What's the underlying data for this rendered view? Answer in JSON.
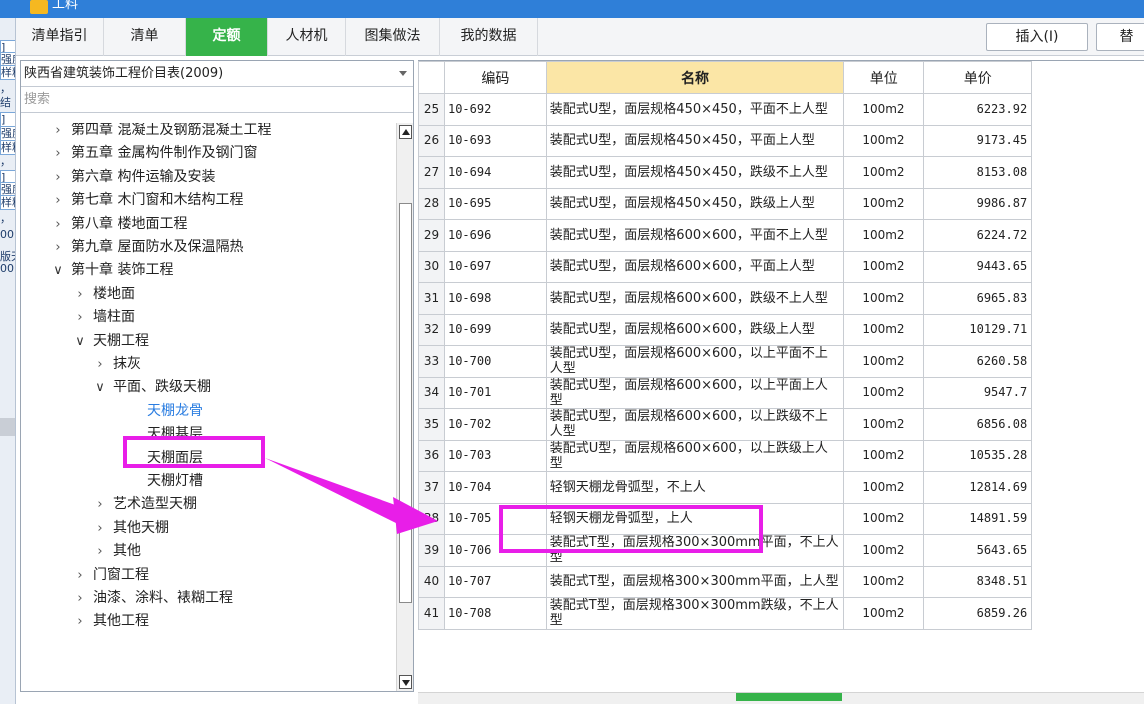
{
  "window": {
    "title": "工料"
  },
  "left_sliver": {
    "fragments": [
      "]",
      "强度",
      "样料",
      "，",
      "结",
      "]",
      "强度",
      "样料",
      "，",
      "]",
      "强度",
      "样料",
      "，",
      "00",
      "版天",
      "00"
    ]
  },
  "tabs": [
    {
      "label": "清单指引",
      "active": false
    },
    {
      "label": "清单",
      "active": false
    },
    {
      "label": "定额",
      "active": true
    },
    {
      "label": "人材机",
      "active": false
    },
    {
      "label": "图集做法",
      "active": false
    },
    {
      "label": "我的数据",
      "active": false
    }
  ],
  "toolbar": {
    "insert_label": "插入(I)",
    "replace_label": "替"
  },
  "library": {
    "selected": "陕西省建筑装饰工程价目表(2009)"
  },
  "search": {
    "placeholder": "搜索"
  },
  "tree": [
    {
      "label": "第四章 混凝土及钢筋混凝土工程",
      "level": 0,
      "expanded": false
    },
    {
      "label": "第五章 金属构件制作及钢门窗",
      "level": 0,
      "expanded": false
    },
    {
      "label": "第六章 构件运输及安装",
      "level": 0,
      "expanded": false
    },
    {
      "label": "第七章 木门窗和木结构工程",
      "level": 0,
      "expanded": false
    },
    {
      "label": "第八章 楼地面工程",
      "level": 0,
      "expanded": false
    },
    {
      "label": "第九章 屋面防水及保温隔热",
      "level": 0,
      "expanded": false
    },
    {
      "label": "第十章 装饰工程",
      "level": 0,
      "expanded": true
    },
    {
      "label": "楼地面",
      "level": 1,
      "expanded": false
    },
    {
      "label": "墙柱面",
      "level": 1,
      "expanded": false
    },
    {
      "label": "天棚工程",
      "level": 1,
      "expanded": true
    },
    {
      "label": "抹灰",
      "level": 2,
      "expanded": false
    },
    {
      "label": "平面、跌级天棚",
      "level": 2,
      "expanded": true
    },
    {
      "label": "天棚龙骨",
      "level": 3,
      "leaf": true,
      "selected": true
    },
    {
      "label": "天棚基层",
      "level": 3,
      "leaf": true
    },
    {
      "label": "天棚面层",
      "level": 3,
      "leaf": true
    },
    {
      "label": "天棚灯槽",
      "level": 3,
      "leaf": true
    },
    {
      "label": "艺术造型天棚",
      "level": 2,
      "expanded": false
    },
    {
      "label": "其他天棚",
      "level": 2,
      "expanded": false
    },
    {
      "label": "其他",
      "level": 2,
      "expanded": false
    },
    {
      "label": "门窗工程",
      "level": 1,
      "expanded": false
    },
    {
      "label": "油漆、涂料、裱糊工程",
      "level": 1,
      "expanded": false
    },
    {
      "label": "其他工程",
      "level": 1,
      "expanded": false
    }
  ],
  "table": {
    "headers": {
      "code": "编码",
      "name": "名称",
      "unit": "单位",
      "price": "单价"
    },
    "rows": [
      {
        "idx": "25",
        "code": "10-692",
        "name": "装配式U型，面层规格450×450，平面不上人型",
        "unit": "100m2",
        "price": "6223.92"
      },
      {
        "idx": "26",
        "code": "10-693",
        "name": "装配式U型，面层规格450×450，平面上人型",
        "unit": "100m2",
        "price": "9173.45"
      },
      {
        "idx": "27",
        "code": "10-694",
        "name": "装配式U型，面层规格450×450，跌级不上人型",
        "unit": "100m2",
        "price": "8153.08"
      },
      {
        "idx": "28",
        "code": "10-695",
        "name": "装配式U型，面层规格450×450，跌级上人型",
        "unit": "100m2",
        "price": "9986.87"
      },
      {
        "idx": "29",
        "code": "10-696",
        "name": "装配式U型，面层规格600×600，平面不上人型",
        "unit": "100m2",
        "price": "6224.72"
      },
      {
        "idx": "30",
        "code": "10-697",
        "name": "装配式U型，面层规格600×600，平面上人型",
        "unit": "100m2",
        "price": "9443.65"
      },
      {
        "idx": "31",
        "code": "10-698",
        "name": "装配式U型，面层规格600×600，跌级不上人型",
        "unit": "100m2",
        "price": "6965.83"
      },
      {
        "idx": "32",
        "code": "10-699",
        "name": "装配式U型，面层规格600×600，跌级上人型",
        "unit": "100m2",
        "price": "10129.71"
      },
      {
        "idx": "33",
        "code": "10-700",
        "name": "装配式U型，面层规格600×600，以上平面不上人型",
        "unit": "100m2",
        "price": "6260.58"
      },
      {
        "idx": "34",
        "code": "10-701",
        "name": "装配式U型，面层规格600×600，以上平面上人型",
        "unit": "100m2",
        "price": "9547.7"
      },
      {
        "idx": "35",
        "code": "10-702",
        "name": "装配式U型，面层规格600×600，以上跌级不上人型",
        "unit": "100m2",
        "price": "6856.08"
      },
      {
        "idx": "36",
        "code": "10-703",
        "name": "装配式U型，面层规格600×600，以上跌级上人型",
        "unit": "100m2",
        "price": "10535.28"
      },
      {
        "idx": "37",
        "code": "10-704",
        "name": "轻钢天棚龙骨弧型，不上人",
        "unit": "100m2",
        "price": "12814.69"
      },
      {
        "idx": "38",
        "code": "10-705",
        "name": "轻钢天棚龙骨弧型，上人",
        "unit": "100m2",
        "price": "14891.59"
      },
      {
        "idx": "39",
        "code": "10-706",
        "name": "装配式T型，面层规格300×300mm平面，不上人型",
        "unit": "100m2",
        "price": "5643.65"
      },
      {
        "idx": "40",
        "code": "10-707",
        "name": "装配式T型，面层规格300×300mm平面，上人型",
        "unit": "100m2",
        "price": "8348.51"
      },
      {
        "idx": "41",
        "code": "10-708",
        "name": "装配式T型，面层规格300×300mm跌级，不上人型",
        "unit": "100m2",
        "price": "6859.26"
      }
    ]
  },
  "colors": {
    "accent_green": "#36b34a",
    "highlight_magenta": "#e81ee8",
    "header_name_bg": "#fbe6a6",
    "selected_text": "#2a7de1"
  }
}
